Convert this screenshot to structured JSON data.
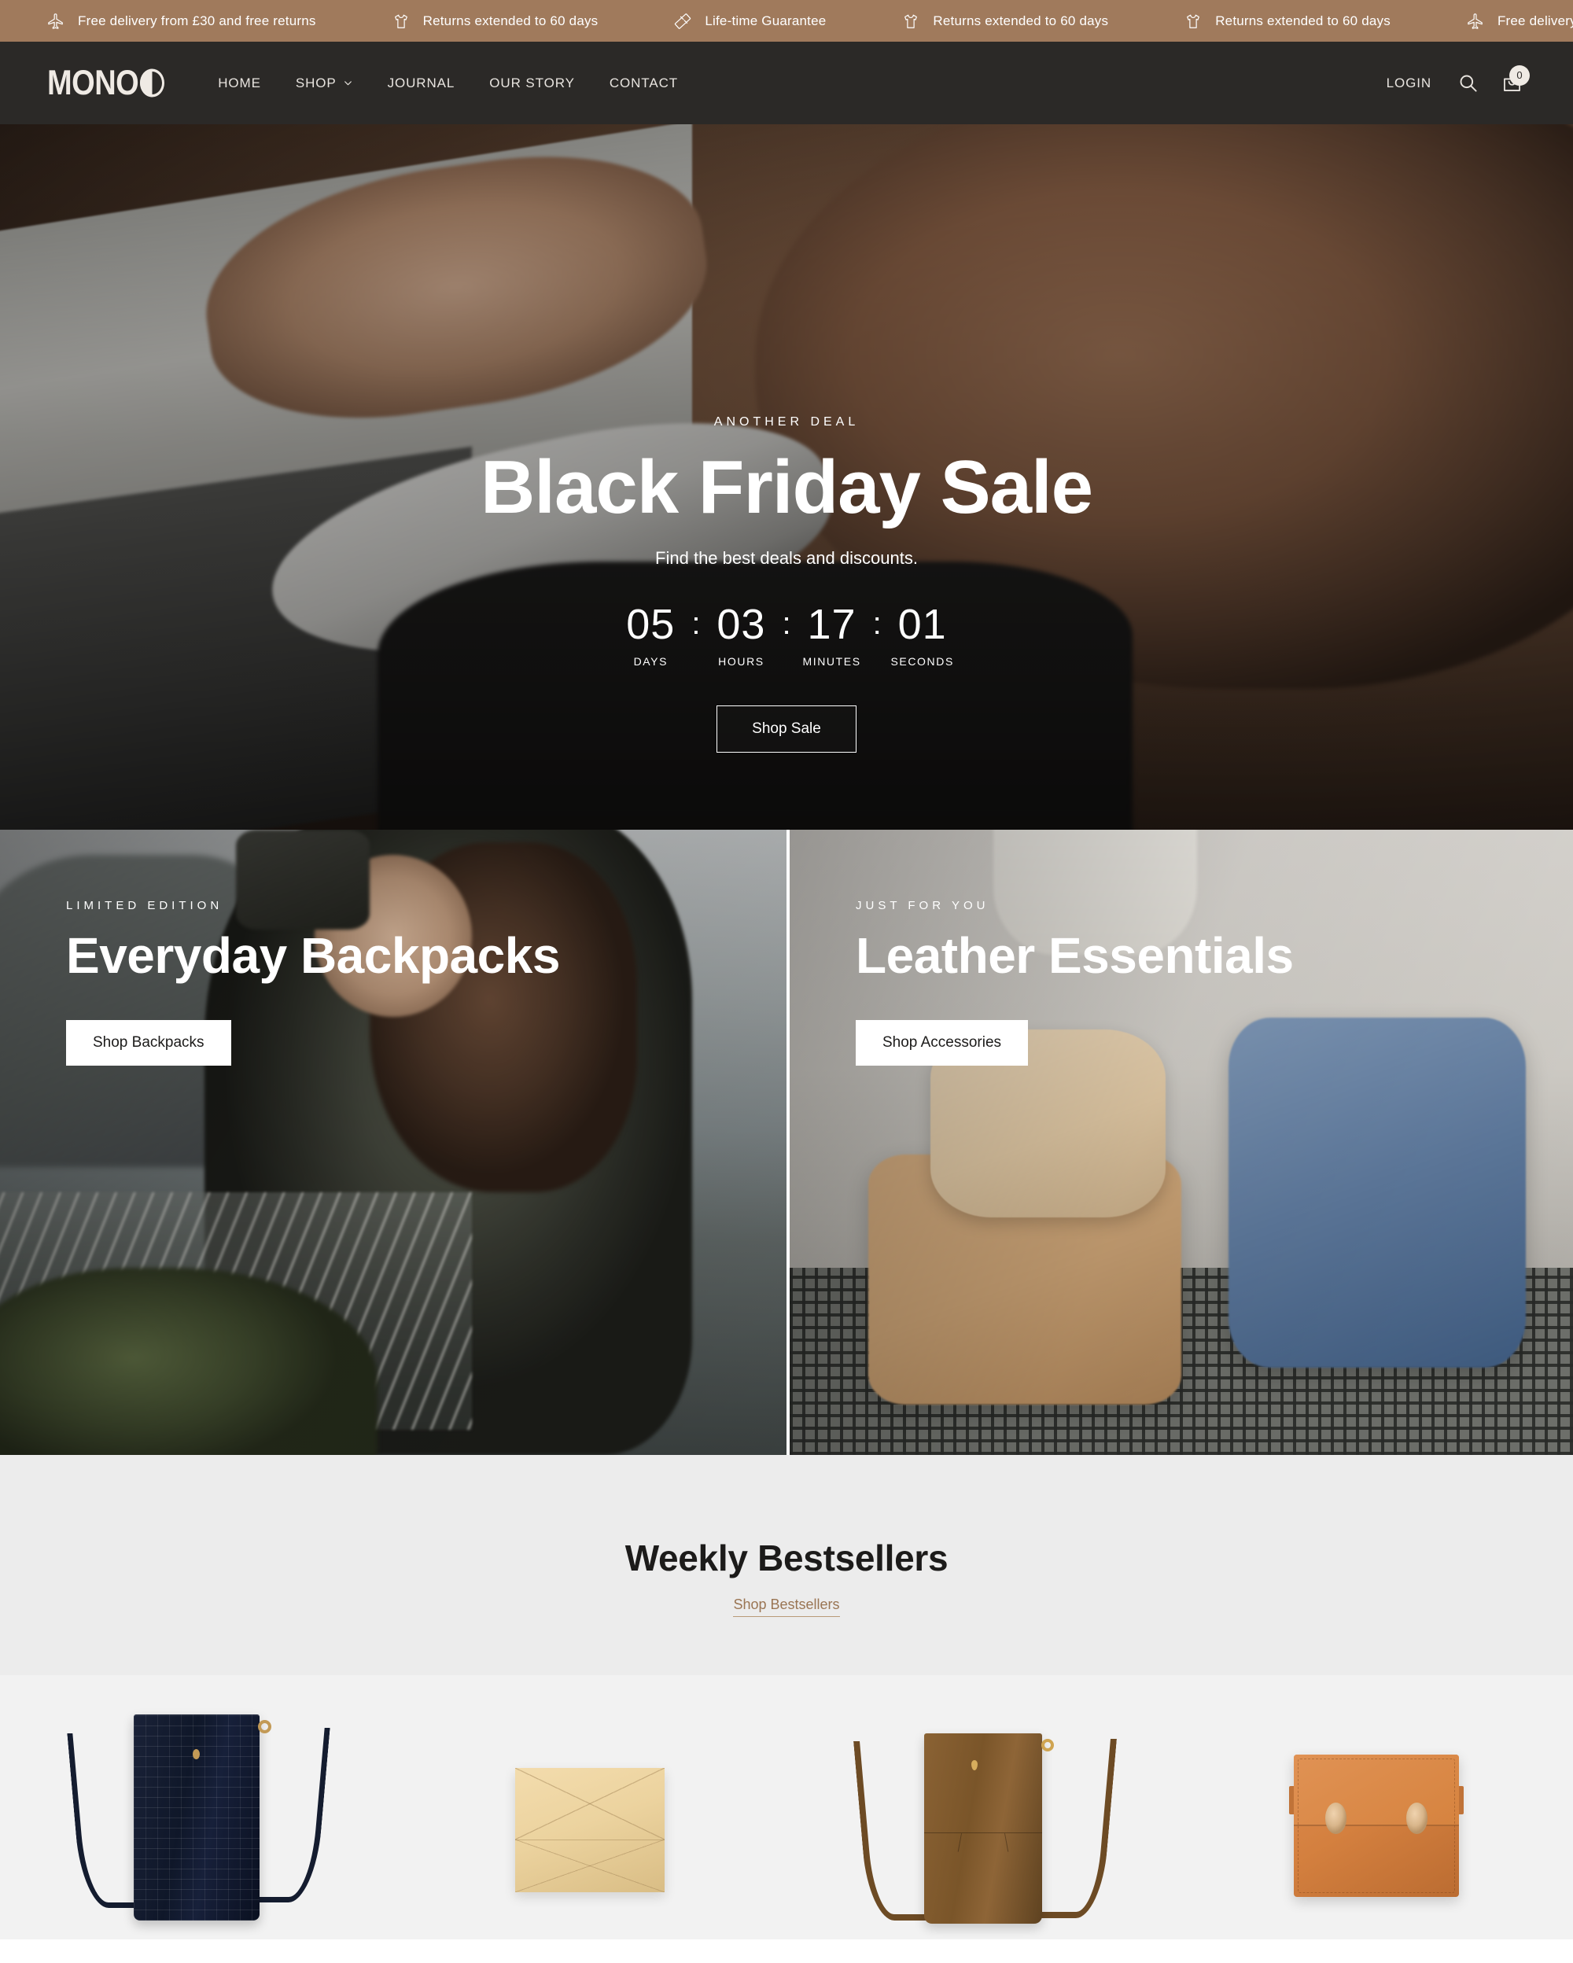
{
  "announcement": {
    "items": [
      {
        "icon": "airplane-icon",
        "text": "Free delivery from £30 and free returns"
      },
      {
        "icon": "tshirt-icon",
        "text": "Returns extended to 60 days"
      },
      {
        "icon": "ruler-icon",
        "text": "Life-time Guarantee"
      },
      {
        "icon": "tshirt-icon",
        "text": "Returns extended to 60 days"
      },
      {
        "icon": "tshirt-icon",
        "text": "Returns extended to 60 days"
      },
      {
        "icon": "airplane-icon",
        "text": "Free delivery"
      }
    ],
    "background_color": "#a07a5c",
    "text_color": "#ffffff"
  },
  "header": {
    "logo_text": "MONO",
    "background_color": "#2b2927",
    "nav": [
      {
        "label": "HOME",
        "has_dropdown": false
      },
      {
        "label": "SHOP",
        "has_dropdown": true
      },
      {
        "label": "JOURNAL",
        "has_dropdown": false
      },
      {
        "label": "OUR STORY",
        "has_dropdown": false
      },
      {
        "label": "CONTACT",
        "has_dropdown": false
      }
    ],
    "login_label": "LOGIN",
    "search_icon": "search-icon",
    "cart_icon": "shopping-bag-icon",
    "cart_count": "0"
  },
  "hero": {
    "eyebrow": "ANOTHER DEAL",
    "title": "Black Friday Sale",
    "subtitle": "Find the best deals and discounts.",
    "countdown": [
      {
        "value": "05",
        "label": "DAYS"
      },
      {
        "value": "03",
        "label": "HOURS"
      },
      {
        "value": "17",
        "label": "MINUTES"
      },
      {
        "value": "01",
        "label": "SECONDS"
      }
    ],
    "separator": ":",
    "cta_label": "Shop Sale"
  },
  "promos": [
    {
      "eyebrow": "LIMITED EDITION",
      "title": "Everyday Backpacks",
      "cta_label": "Shop Backpacks"
    },
    {
      "eyebrow": "JUST FOR YOU",
      "title": "Leather Essentials",
      "cta_label": "Shop Accessories"
    }
  ],
  "bestsellers": {
    "title": "Weekly Bestsellers",
    "link_label": "Shop Bestsellers",
    "link_color": "#9a7553",
    "background_color": "#ececec",
    "products": [
      {
        "name": "navy-crocodile-bucket-bag"
      },
      {
        "name": "cream-envelope-wallet"
      },
      {
        "name": "brown-suede-bucket-bag"
      },
      {
        "name": "tan-leather-box-bag"
      }
    ]
  }
}
